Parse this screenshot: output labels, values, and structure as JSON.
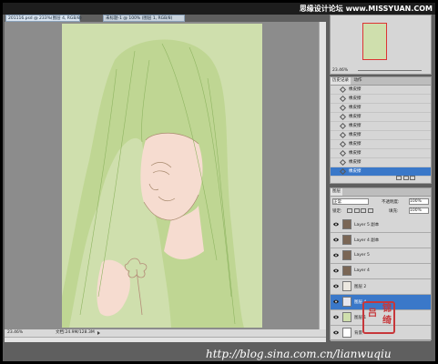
{
  "watermark_top": "思缘设计论坛 www.MISSYUAN.COM",
  "watermark_bottom": "http://blog.sina.com.cn/lianwuqiu",
  "tabs": [
    {
      "label": "201116.psd @ 233%(图层 4, RGB/8)"
    },
    {
      "label": "未标题-1 @ 100% (图层 1, RGB/8)"
    }
  ],
  "status": {
    "zoom": "23.46%",
    "doc": "文档:24.9M/128.3M"
  },
  "navigator": {
    "zoom": "23.46%"
  },
  "history": {
    "tabs": [
      "历史记录",
      "动作"
    ],
    "items": [
      {
        "label": "橡皮擦"
      },
      {
        "label": "橡皮擦"
      },
      {
        "label": "橡皮擦"
      },
      {
        "label": "橡皮擦"
      },
      {
        "label": "橡皮擦"
      },
      {
        "label": "橡皮擦"
      },
      {
        "label": "橡皮擦"
      },
      {
        "label": "橡皮擦"
      },
      {
        "label": "橡皮擦"
      },
      {
        "label": "橡皮擦"
      }
    ],
    "selected_index": 9
  },
  "layers": {
    "tab": "图层",
    "blend_mode": "正常",
    "opacity_label": "不透明度:",
    "opacity_value": "100%",
    "lock_label": "锁定:",
    "fill_label": "填充:",
    "fill_value": "100%",
    "items": [
      {
        "name": "Layer 5 副本",
        "thumb": "#7a6655"
      },
      {
        "name": "Layer 4 副本",
        "thumb": "#7a6655"
      },
      {
        "name": "Layer 5",
        "thumb": "#7a6655"
      },
      {
        "name": "Layer 4",
        "thumb": "#7a6655"
      },
      {
        "name": "图层 2",
        "thumb": "#ece8e0"
      },
      {
        "name": "图层 4",
        "thumb": "#e6e6ee"
      },
      {
        "name": "图层 1",
        "thumb": "#cfdfad"
      },
      {
        "name": "背景",
        "thumb": "#ffffff"
      }
    ],
    "selected_index": 5
  },
  "seal": {
    "chars": [
      "吕",
      "锦",
      "绮"
    ],
    "color": "#c7373a"
  },
  "colors": {
    "canvas": "#cfdfad",
    "hair": "#7fae4e",
    "skin": "#f6dcd0",
    "selection": "#3a78c9"
  }
}
